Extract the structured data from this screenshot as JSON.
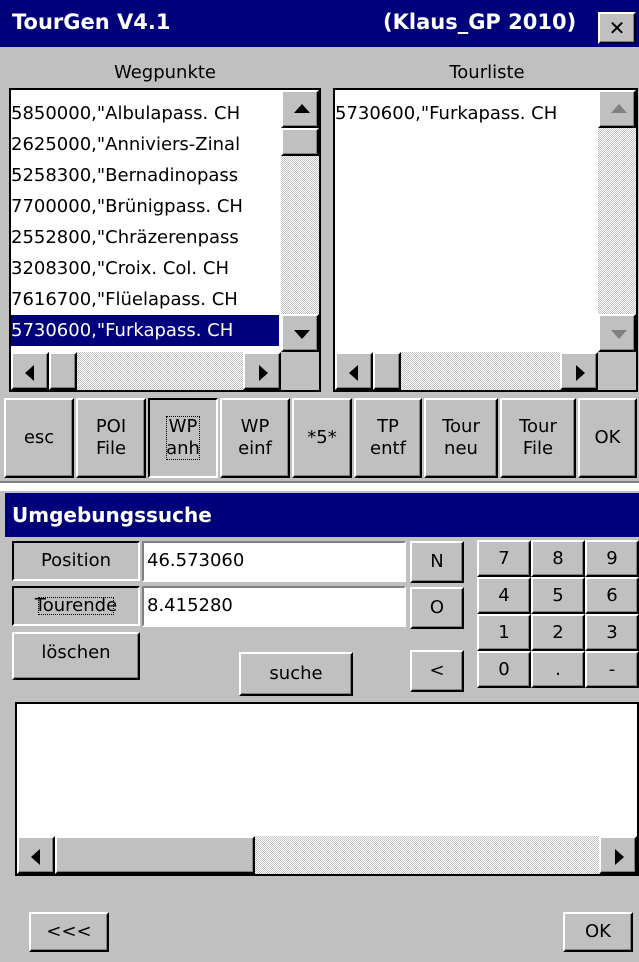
{
  "window": {
    "title_left": "TourGen V4.1",
    "title_right": "(Klaus_GP 2010)",
    "close_glyph": "✕"
  },
  "waypoints": {
    "header": "Wegpunkte",
    "items": [
      "5850000,\"Albulapass. CH",
      "2625000,\"Anniviers-Zinal",
      "5258300,\"Bernadinopass",
      "7700000,\"Brünigpass. CH",
      "2552800,\"Chräzerenpass",
      "3208300,\"Croix. Col. CH",
      "7616700,\"Flüelapass. CH",
      "5730600,\"Furkapass. CH"
    ],
    "selected_index": 7
  },
  "tourlist": {
    "header": "Tourliste",
    "items": [
      "5730600,\"Furkapass. CH"
    ]
  },
  "toolbar": {
    "esc": "esc",
    "poi_file": [
      "POI",
      "File"
    ],
    "wp_anh": [
      "WP",
      "anh"
    ],
    "wp_einf": [
      "WP",
      "einf"
    ],
    "five": "*5*",
    "tp_entf": [
      "TP",
      "entf"
    ],
    "tour_neu": [
      "Tour",
      "neu"
    ],
    "tour_file": [
      "Tour",
      "File"
    ],
    "ok": "OK"
  },
  "search": {
    "title": "Umgebungssuche",
    "position_label": "Position",
    "position_value": "46.573060",
    "tourende_label": "Tourende",
    "tourende_value": "8.415280",
    "loeschen_label": "löschen",
    "suche_label": "suche",
    "n_label": "N",
    "o_label": "O",
    "back_label": "<",
    "keypad": [
      "7",
      "8",
      "9",
      "4",
      "5",
      "6",
      "1",
      "2",
      "3",
      "0",
      ".",
      "-"
    ],
    "prev_label": "<<<",
    "ok_label": "OK"
  },
  "colors": {
    "titlebar": "#00007b",
    "face": "#c0c0c0",
    "selection": "#00007b"
  }
}
